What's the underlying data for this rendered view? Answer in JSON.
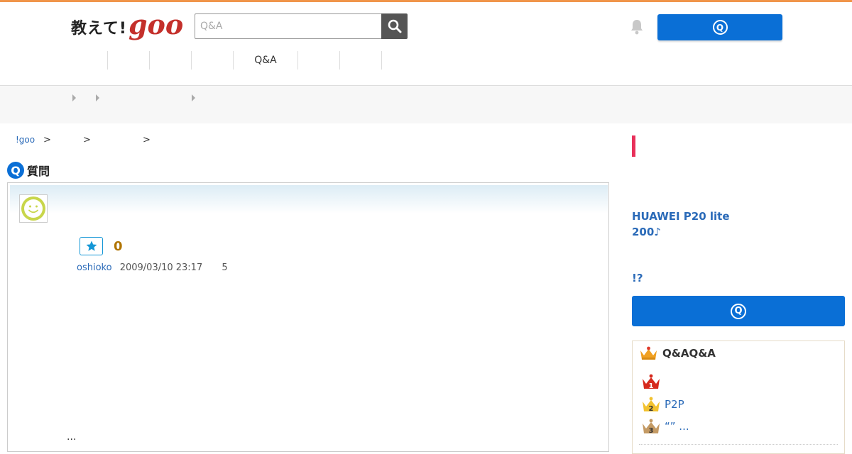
{
  "header": {
    "logo_prefix": "教えて!",
    "logo_goo": "goo",
    "search_placeholder": "Q&A",
    "ask_button_label": "Q",
    "nav_items": [
      "",
      "",
      "",
      "",
      "Q&A",
      "",
      ""
    ]
  },
  "breadcrumb": {
    "home": "!goo",
    "sep1": ">",
    "sep2": ">",
    "sep3": ">"
  },
  "question": {
    "heading_badge": "Q",
    "heading": "質問",
    "star_count": "0",
    "username": "oshioko",
    "datetime": "2009/03/10 23:17",
    "answer_count": "5",
    "body_ellipsis": "..."
  },
  "sidebar": {
    "promo_line1": "HUAWEI P20 lite",
    "promo_line2": "200♪",
    "promo_question": "!?",
    "ask_button_label": "Q",
    "ranking_title": "Q&AQ&A",
    "ranking": [
      {
        "rank": "1",
        "text": ""
      },
      {
        "rank": "2",
        "text": "P2P"
      },
      {
        "rank": "3",
        "text": "“” ..."
      }
    ]
  },
  "colors": {
    "accent": "#0a6fd6",
    "top_border": "#f0954a",
    "logo_red": "#c4302b",
    "star_count": "#b07400",
    "section_marker": "#e8305a"
  }
}
